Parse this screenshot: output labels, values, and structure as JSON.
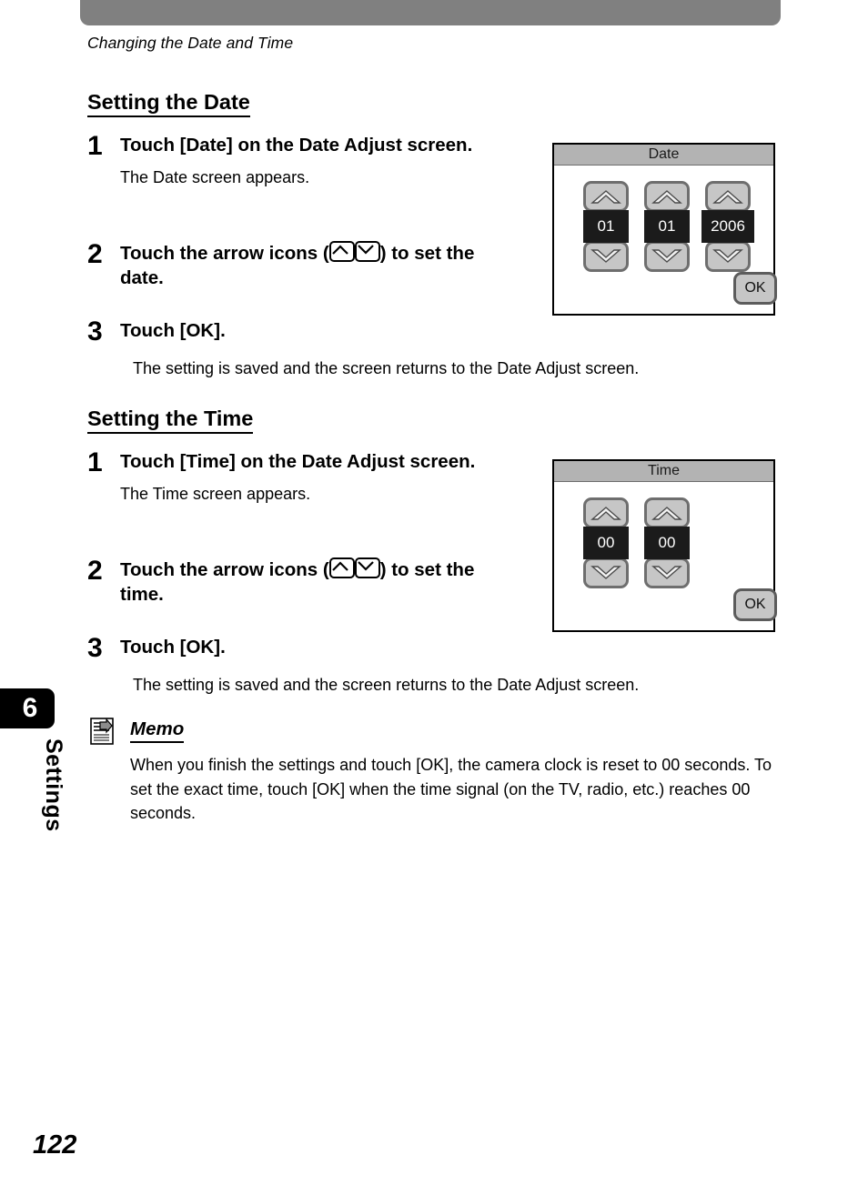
{
  "header": {
    "breadcrumb": "Changing the Date and Time"
  },
  "chapter": {
    "number": "6",
    "name": "Settings"
  },
  "page_number": "122",
  "sections": [
    {
      "title": "Setting the Date",
      "steps": [
        {
          "num": "1",
          "title_before": "Touch [Date] on the Date Adjust screen.",
          "desc": "The Date screen appears."
        },
        {
          "num": "2",
          "title_before": "Touch the arrow icons (",
          "title_after": ") to set the date.",
          "desc": ""
        },
        {
          "num": "3",
          "title_before": "Touch [OK].",
          "desc": "The setting is saved and the screen returns to the Date Adjust screen."
        }
      ]
    },
    {
      "title": "Setting the Time",
      "steps": [
        {
          "num": "1",
          "title_before": "Touch [Time] on the Date Adjust screen.",
          "desc": "The Time screen appears."
        },
        {
          "num": "2",
          "title_before": "Touch the arrow icons (",
          "title_after": ") to set the time.",
          "desc": ""
        },
        {
          "num": "3",
          "title_before": "Touch [OK].",
          "desc": "The setting is saved and the screen returns to the Date Adjust screen."
        }
      ]
    }
  ],
  "date_screen": {
    "title": "Date",
    "fields": [
      {
        "value": "01",
        "name": "month"
      },
      {
        "value": "01",
        "name": "day"
      },
      {
        "value": "2006",
        "name": "year"
      }
    ],
    "ok_label": "OK"
  },
  "time_screen": {
    "title": "Time",
    "fields": [
      {
        "value": "00",
        "name": "hour"
      },
      {
        "value": "00",
        "name": "minute"
      }
    ],
    "ok_label": "OK"
  },
  "memo": {
    "title": "Memo",
    "text": "When you finish the settings and touch [OK], the camera clock is reset to 00 seconds. To set the exact time, touch [OK] when the time signal (on the TV, radio, etc.) reaches 00 seconds."
  },
  "colors": {
    "header_bar": "#808080",
    "screen_title_bar": "#b3b3b3",
    "button_face": "#c6c6c6",
    "button_border": "#6e6e6e",
    "value_box": "#1b1b1b"
  }
}
